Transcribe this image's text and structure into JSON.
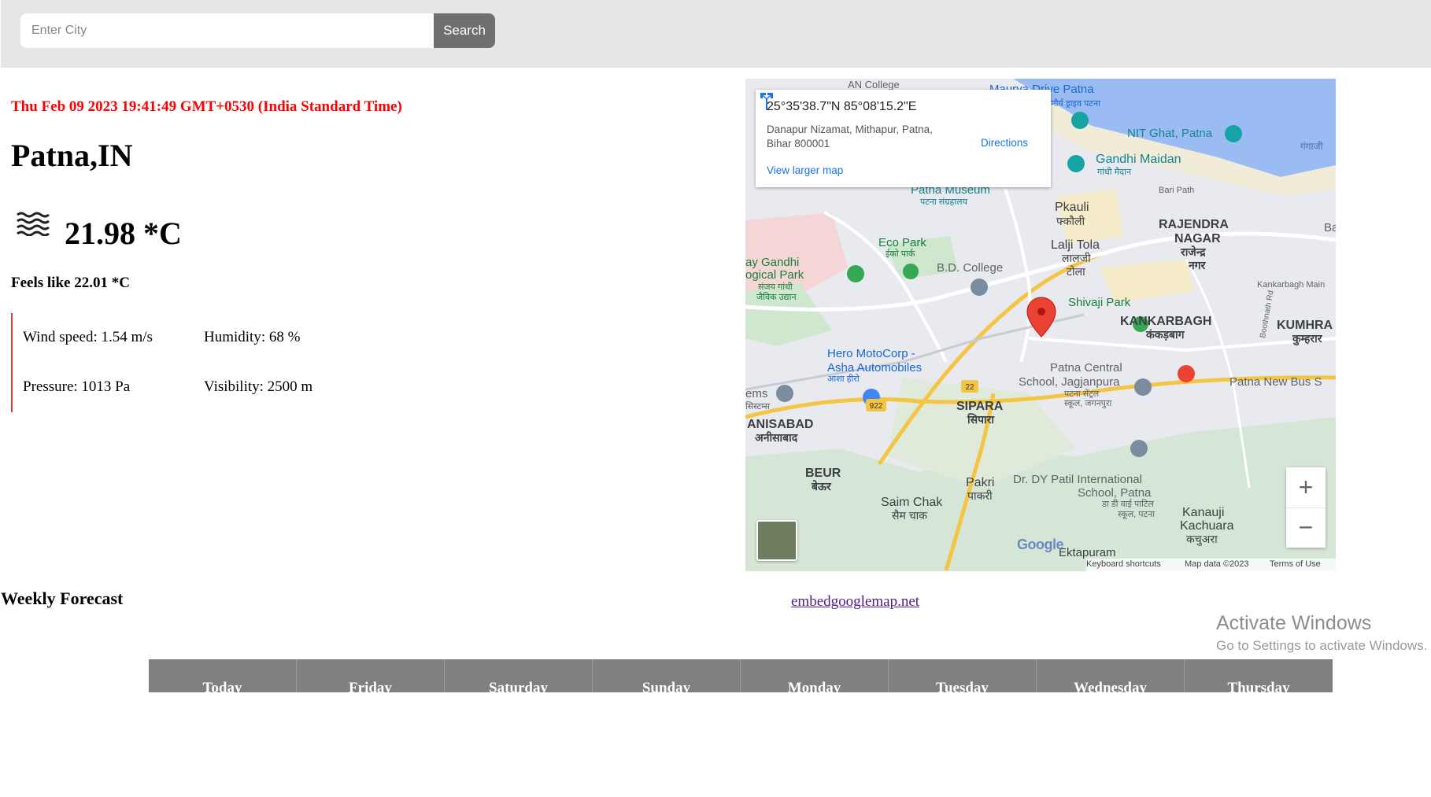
{
  "search": {
    "placeholder": "Enter City",
    "button_label": "Search"
  },
  "weather": {
    "datetime": "Thu Feb 09 2023 19:41:49 GMT+0530 (India Standard Time)",
    "city": "Patna,IN",
    "condition_icon": "haze-icon",
    "temperature": "21.98 *C",
    "feels_like": "Feels like 22.01 *C",
    "details": {
      "wind": "Wind speed: 1.54 m/s",
      "humidity": "Humidity: 68 %",
      "pressure": "Pressure: 1013 Pa",
      "visibility": "Visibility: 2500 m"
    }
  },
  "map": {
    "card": {
      "coords": "25°35'38.7\"N 85°08'15.2\"E",
      "address": "Danapur Nizamat, Mithapur, Patna, Bihar 800001",
      "directions": "Directions",
      "view_larger": "View larger map"
    },
    "labels": [
      "AN College",
      "Maurya Drive Patna",
      "मौर्य ड्राइव पटना",
      "NIT Ghat, Patna",
      "गंगाजी",
      "Gandhi Maidan",
      "गांधी मैदान",
      "Patna Museum",
      "पटना संग्रहालय",
      "Bari Path",
      "Pkauli",
      "फ्कौली",
      "RAJENDRA",
      "NAGAR",
      "राजेन्द्र",
      "नगर",
      "Eco Park",
      "ईको पार्क",
      "B.D. College",
      "Lalji Tola",
      "लालजी",
      "टोला",
      "ay Gandhi",
      "ogical Park",
      "संजय गांधी",
      "जैविक उद्यान",
      "Kankarbagh Main",
      "Shivaji Park",
      "KANKARBAGH",
      "कंकड़बाग",
      "KUMHRA",
      "कुम्हरार",
      "Hero MotoCorp -",
      "Asha Automobiles",
      "आशा हीरो",
      "Patna Central",
      "School, Jagjanpura",
      "पटना सेंट्रल",
      "स्कूल, जगनपुरा",
      "Patna New Bus S",
      "ems",
      "सिस्टम्स",
      "SIPARA",
      "सिपारा",
      "ANISABAD",
      "अनीसाबाद",
      "BEUR",
      "बेऊर",
      "Pakri",
      "पाकरी",
      "Dr. DY Patil International",
      "School, Patna",
      "डा डी वाई पाटिल",
      "स्कूल, पटना",
      "Saim Chak",
      "सैम चाक",
      "Kanauji",
      "Kachuara",
      "कचुअरा",
      "Ektapuram",
      "Boothnath Rd",
      "Ba"
    ],
    "road_shields": [
      "22",
      "922"
    ],
    "google": "Google",
    "footer": {
      "shortcuts": "Keyboard shortcuts",
      "data": "Map data ©2023",
      "terms": "Terms of Use"
    },
    "zoom_in": "+",
    "zoom_out": "−"
  },
  "forecast": {
    "title": "Weekly Forecast",
    "days": [
      "Today",
      "Friday",
      "Saturday",
      "Sunday",
      "Monday",
      "Tuesday",
      "Wednesday",
      "Thursday"
    ]
  },
  "credit_link": "embedgooglemap.net",
  "activation": {
    "title": "Activate Windows",
    "subtitle": "Go to Settings to activate Windows."
  },
  "colors": {
    "date_red": "#ff0000",
    "detail_border": "#e53935",
    "button": "#6f6f6f",
    "table_header": "#808080",
    "map_link": "#1a73e8",
    "pin": "#e53935"
  }
}
